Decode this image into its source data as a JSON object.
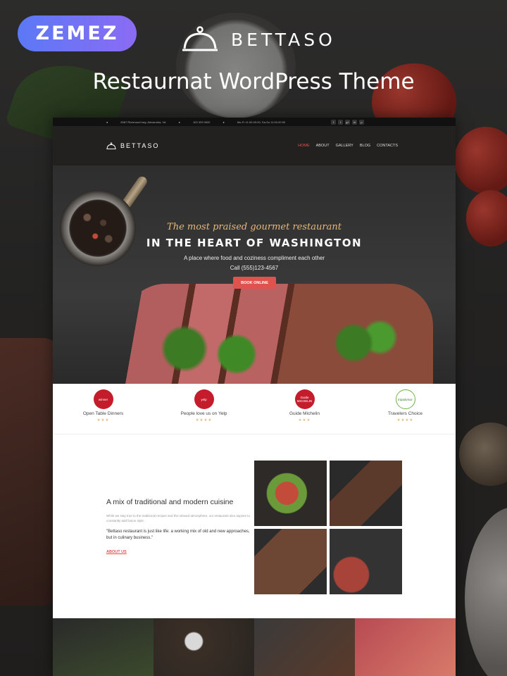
{
  "branding": {
    "zemez": "ZEMEZ",
    "brand_name": "BETTASO",
    "headline": "Restaurnat WordPress Theme"
  },
  "site": {
    "topbar": {
      "address": "6087 Richmond hwy, Alexandria, VA",
      "phone": "103 329 0632",
      "hours": "Mo-Fr 11:00-00:00, Sa-Su 11:00-00:00",
      "social_icons": [
        "facebook-icon",
        "twitter-icon",
        "google-plus-icon",
        "linkedin-icon",
        "pinterest-icon"
      ],
      "social_glyphs": [
        "f",
        "t",
        "g+",
        "in",
        "p"
      ]
    },
    "nav": {
      "logo": "BETTASO",
      "menu": [
        "HOME",
        "ABOUT",
        "GALLERY",
        "BLOG",
        "CONTACTS"
      ],
      "active": "HOME"
    },
    "hero": {
      "tagline": "The most praised gourmet restaurant",
      "title": "IN THE HEART OF WASHINGTON",
      "subtitle": "A place where food and coziness compliment each other",
      "call": "Call (555)123-4567",
      "cta": "BOOK ONLINE"
    },
    "awards": [
      {
        "badge": "winner",
        "label": "Open Table Dinners",
        "stars": "★★★"
      },
      {
        "badge": "yelp",
        "label": "People love us on Yelp",
        "stars": "★★★★"
      },
      {
        "badge": "Guide MICHELIN",
        "label": "Guide Michelin",
        "stars": "★★★"
      },
      {
        "badge": "tripadvisor",
        "label": "Travelers Choice",
        "stars": "★★★★"
      }
    ],
    "about": {
      "heading": "A mix of traditional and modern cuisine",
      "body": "While we stay true to the traditional recipes and the relaxed atmosphere, our restaurant also aspires to constantly add fusion style.",
      "quote": "\"Bettaso restaurant is just like life: a working mix of old and new approaches, but in culinary business.\"",
      "link": "ABOUT US"
    },
    "colors": {
      "accent": "#e0524d",
      "gold": "#e6b97b",
      "badge_gradient_start": "#5b79f5",
      "badge_gradient_end": "#8b6bf4"
    }
  }
}
